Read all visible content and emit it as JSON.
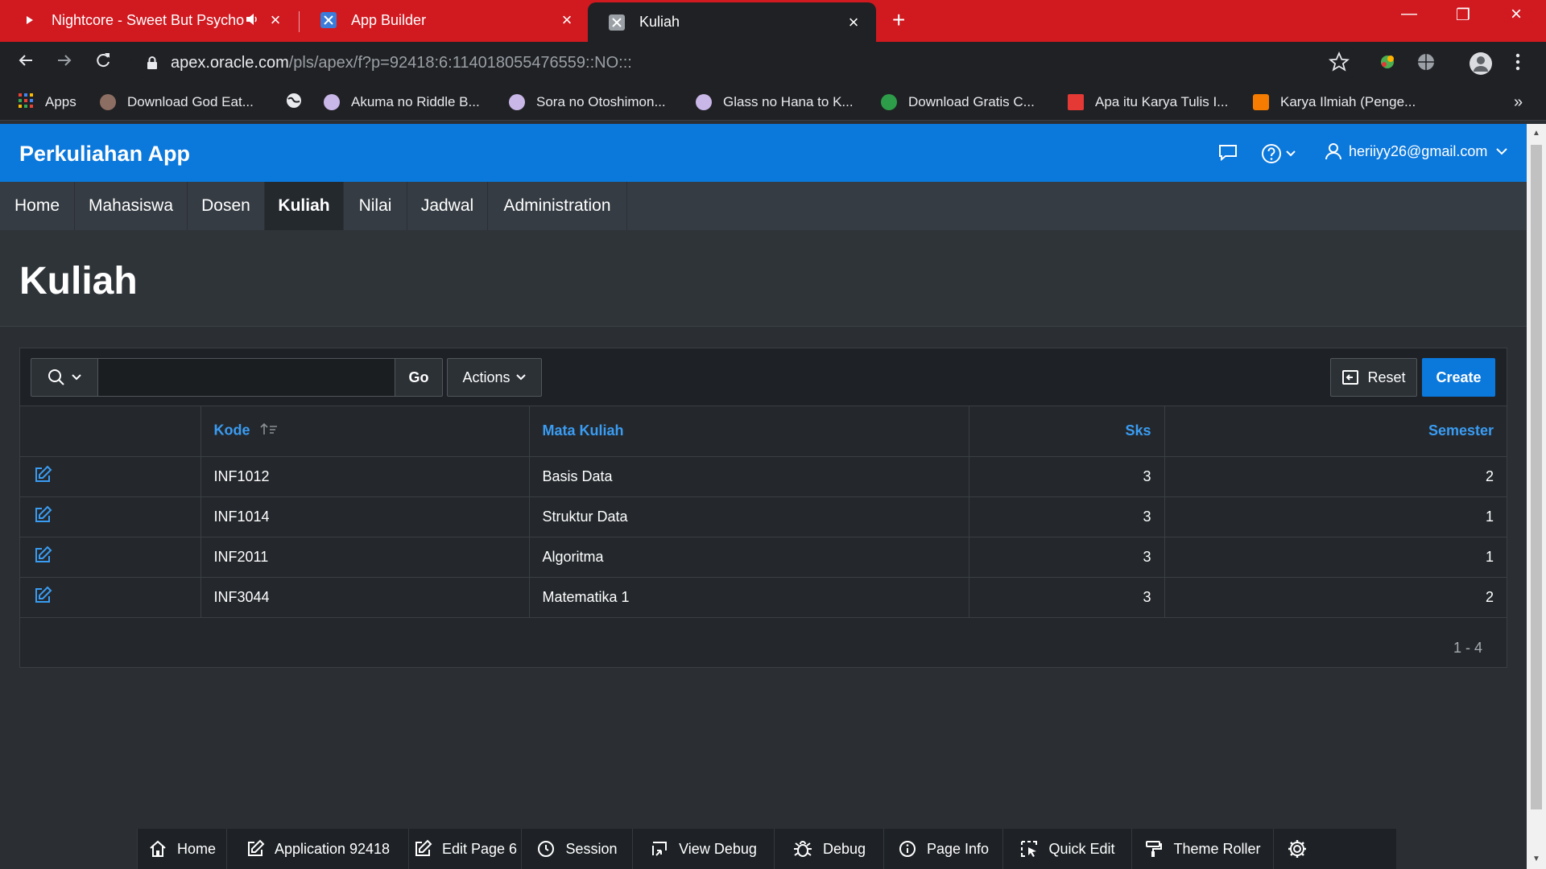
{
  "browser": {
    "tabs": [
      {
        "title": "Nightcore - Sweet But Psycho",
        "icon": "youtube-icon"
      },
      {
        "title": "App Builder",
        "icon": "apex-icon"
      },
      {
        "title": "Kuliah",
        "icon": "apex-icon"
      }
    ],
    "url_host": "apex.oracle.com",
    "url_rest": "/pls/apex/f?p=92418:6:114018055476559::NO:::",
    "bookmarks": [
      "Apps",
      "Download God Eat...",
      "",
      "Akuma no Riddle B...",
      "Sora no Otoshimon...",
      "Glass no Hana to K...",
      "Download Gratis C...",
      "Apa itu Karya Tulis I...",
      "Karya Ilmiah (Penge..."
    ],
    "overflow": "»"
  },
  "app": {
    "name": "Perkuliahan App",
    "user": "heriiyy26@gmail.com",
    "accent_color": "#0b78dc"
  },
  "nav": {
    "items": [
      "Home",
      "Mahasiswa",
      "Dosen",
      "Kuliah",
      "Nilai",
      "Jadwal",
      "Administration"
    ],
    "active": "Kuliah"
  },
  "page": {
    "title": "Kuliah"
  },
  "report": {
    "search": {
      "value": "",
      "go_label": "Go"
    },
    "actions_label": "Actions",
    "reset_label": "Reset",
    "create_label": "Create",
    "columns": [
      "Kode",
      "Mata Kuliah",
      "Sks",
      "Semester"
    ],
    "sorted_column": "Kode",
    "rows": [
      {
        "kode": "INF1012",
        "mata_kuliah": "Basis Data",
        "sks": "3",
        "semester": "2"
      },
      {
        "kode": "INF1014",
        "mata_kuliah": "Struktur Data",
        "sks": "3",
        "semester": "1"
      },
      {
        "kode": "INF2011",
        "mata_kuliah": "Algoritma",
        "sks": "3",
        "semester": "1"
      },
      {
        "kode": "INF3044",
        "mata_kuliah": "Matematika 1",
        "sks": "3",
        "semester": "2"
      }
    ],
    "pagination": "1 - 4"
  },
  "devbar": {
    "items": [
      {
        "label": "Home",
        "icon": "home-icon"
      },
      {
        "label": "Application 92418",
        "icon": "edit-icon"
      },
      {
        "label": "Edit Page 6",
        "icon": "edit-icon"
      },
      {
        "label": "Session",
        "icon": "clock-icon"
      },
      {
        "label": "View Debug",
        "icon": "view-debug-icon"
      },
      {
        "label": "Debug",
        "icon": "bug-icon"
      },
      {
        "label": "Page Info",
        "icon": "info-icon"
      },
      {
        "label": "Quick Edit",
        "icon": "quick-edit-icon"
      },
      {
        "label": "Theme Roller",
        "icon": "paint-roller-icon"
      },
      {
        "label": "",
        "icon": "gear-icon"
      }
    ]
  }
}
